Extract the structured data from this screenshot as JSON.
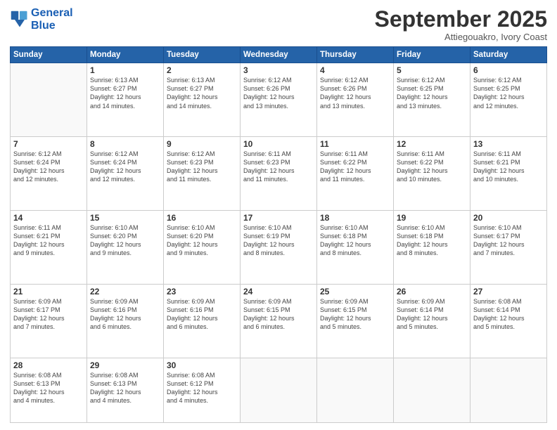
{
  "logo": {
    "line1": "General",
    "line2": "Blue"
  },
  "header": {
    "month_year": "September 2025",
    "location": "Attiegouakro, Ivory Coast"
  },
  "weekdays": [
    "Sunday",
    "Monday",
    "Tuesday",
    "Wednesday",
    "Thursday",
    "Friday",
    "Saturday"
  ],
  "weeks": [
    [
      {
        "day": "",
        "info": ""
      },
      {
        "day": "1",
        "info": "Sunrise: 6:13 AM\nSunset: 6:27 PM\nDaylight: 12 hours\nand 14 minutes."
      },
      {
        "day": "2",
        "info": "Sunrise: 6:13 AM\nSunset: 6:27 PM\nDaylight: 12 hours\nand 14 minutes."
      },
      {
        "day": "3",
        "info": "Sunrise: 6:12 AM\nSunset: 6:26 PM\nDaylight: 12 hours\nand 13 minutes."
      },
      {
        "day": "4",
        "info": "Sunrise: 6:12 AM\nSunset: 6:26 PM\nDaylight: 12 hours\nand 13 minutes."
      },
      {
        "day": "5",
        "info": "Sunrise: 6:12 AM\nSunset: 6:25 PM\nDaylight: 12 hours\nand 13 minutes."
      },
      {
        "day": "6",
        "info": "Sunrise: 6:12 AM\nSunset: 6:25 PM\nDaylight: 12 hours\nand 12 minutes."
      }
    ],
    [
      {
        "day": "7",
        "info": "Sunrise: 6:12 AM\nSunset: 6:24 PM\nDaylight: 12 hours\nand 12 minutes."
      },
      {
        "day": "8",
        "info": "Sunrise: 6:12 AM\nSunset: 6:24 PM\nDaylight: 12 hours\nand 12 minutes."
      },
      {
        "day": "9",
        "info": "Sunrise: 6:12 AM\nSunset: 6:23 PM\nDaylight: 12 hours\nand 11 minutes."
      },
      {
        "day": "10",
        "info": "Sunrise: 6:11 AM\nSunset: 6:23 PM\nDaylight: 12 hours\nand 11 minutes."
      },
      {
        "day": "11",
        "info": "Sunrise: 6:11 AM\nSunset: 6:22 PM\nDaylight: 12 hours\nand 11 minutes."
      },
      {
        "day": "12",
        "info": "Sunrise: 6:11 AM\nSunset: 6:22 PM\nDaylight: 12 hours\nand 10 minutes."
      },
      {
        "day": "13",
        "info": "Sunrise: 6:11 AM\nSunset: 6:21 PM\nDaylight: 12 hours\nand 10 minutes."
      }
    ],
    [
      {
        "day": "14",
        "info": "Sunrise: 6:11 AM\nSunset: 6:21 PM\nDaylight: 12 hours\nand 9 minutes."
      },
      {
        "day": "15",
        "info": "Sunrise: 6:10 AM\nSunset: 6:20 PM\nDaylight: 12 hours\nand 9 minutes."
      },
      {
        "day": "16",
        "info": "Sunrise: 6:10 AM\nSunset: 6:20 PM\nDaylight: 12 hours\nand 9 minutes."
      },
      {
        "day": "17",
        "info": "Sunrise: 6:10 AM\nSunset: 6:19 PM\nDaylight: 12 hours\nand 8 minutes."
      },
      {
        "day": "18",
        "info": "Sunrise: 6:10 AM\nSunset: 6:18 PM\nDaylight: 12 hours\nand 8 minutes."
      },
      {
        "day": "19",
        "info": "Sunrise: 6:10 AM\nSunset: 6:18 PM\nDaylight: 12 hours\nand 8 minutes."
      },
      {
        "day": "20",
        "info": "Sunrise: 6:10 AM\nSunset: 6:17 PM\nDaylight: 12 hours\nand 7 minutes."
      }
    ],
    [
      {
        "day": "21",
        "info": "Sunrise: 6:09 AM\nSunset: 6:17 PM\nDaylight: 12 hours\nand 7 minutes."
      },
      {
        "day": "22",
        "info": "Sunrise: 6:09 AM\nSunset: 6:16 PM\nDaylight: 12 hours\nand 6 minutes."
      },
      {
        "day": "23",
        "info": "Sunrise: 6:09 AM\nSunset: 6:16 PM\nDaylight: 12 hours\nand 6 minutes."
      },
      {
        "day": "24",
        "info": "Sunrise: 6:09 AM\nSunset: 6:15 PM\nDaylight: 12 hours\nand 6 minutes."
      },
      {
        "day": "25",
        "info": "Sunrise: 6:09 AM\nSunset: 6:15 PM\nDaylight: 12 hours\nand 5 minutes."
      },
      {
        "day": "26",
        "info": "Sunrise: 6:09 AM\nSunset: 6:14 PM\nDaylight: 12 hours\nand 5 minutes."
      },
      {
        "day": "27",
        "info": "Sunrise: 6:08 AM\nSunset: 6:14 PM\nDaylight: 12 hours\nand 5 minutes."
      }
    ],
    [
      {
        "day": "28",
        "info": "Sunrise: 6:08 AM\nSunset: 6:13 PM\nDaylight: 12 hours\nand 4 minutes."
      },
      {
        "day": "29",
        "info": "Sunrise: 6:08 AM\nSunset: 6:13 PM\nDaylight: 12 hours\nand 4 minutes."
      },
      {
        "day": "30",
        "info": "Sunrise: 6:08 AM\nSunset: 6:12 PM\nDaylight: 12 hours\nand 4 minutes."
      },
      {
        "day": "",
        "info": ""
      },
      {
        "day": "",
        "info": ""
      },
      {
        "day": "",
        "info": ""
      },
      {
        "day": "",
        "info": ""
      }
    ]
  ]
}
